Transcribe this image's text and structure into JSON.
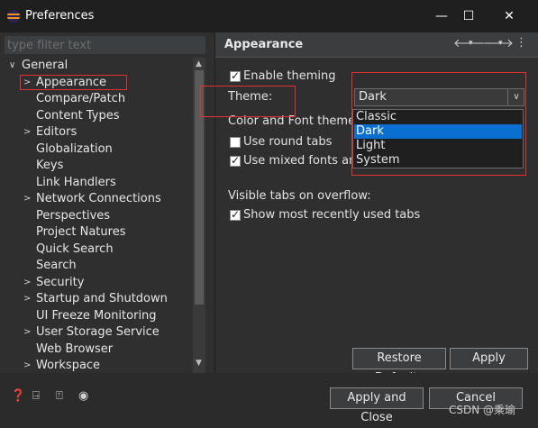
{
  "window": {
    "title": "Preferences",
    "minimize": "—",
    "maximize": "☐",
    "close": "✕"
  },
  "left": {
    "filter_placeholder": "type filter text",
    "tree": [
      {
        "label": "General",
        "chevron": "∨"
      },
      {
        "label": "Appearance",
        "chevron": ">"
      },
      {
        "label": "Compare/Patch",
        "chevron": ""
      },
      {
        "label": "Content Types",
        "chevron": ""
      },
      {
        "label": "Editors",
        "chevron": ">"
      },
      {
        "label": "Globalization",
        "chevron": ""
      },
      {
        "label": "Keys",
        "chevron": ""
      },
      {
        "label": "Link Handlers",
        "chevron": ""
      },
      {
        "label": "Network Connections",
        "chevron": ">"
      },
      {
        "label": "Perspectives",
        "chevron": ""
      },
      {
        "label": "Project Natures",
        "chevron": ""
      },
      {
        "label": "Quick Search",
        "chevron": ""
      },
      {
        "label": "Search",
        "chevron": ""
      },
      {
        "label": "Security",
        "chevron": ">"
      },
      {
        "label": "Startup and Shutdown",
        "chevron": ">"
      },
      {
        "label": "UI Freeze Monitoring",
        "chevron": ""
      },
      {
        "label": "User Storage Service",
        "chevron": ">"
      },
      {
        "label": "Web Browser",
        "chevron": ""
      },
      {
        "label": "Workspace",
        "chevron": ">"
      }
    ]
  },
  "right": {
    "title": "Appearance",
    "enable_theming": "Enable theming",
    "theme_label": "Theme:",
    "theme_value": "Dark",
    "theme_options": [
      "Classic",
      "Dark",
      "Light",
      "System"
    ],
    "color_font_theme_label": "Color and Font theme:",
    "use_round_tabs": "Use round tabs",
    "use_mixed_fonts": "Use mixed fonts and",
    "visible_tabs_label": "Visible tabs on overflow:",
    "show_mru_tabs": "Show most recently used tabs",
    "restore_defaults": "Restore Defaults",
    "apply": "Apply"
  },
  "bottom": {
    "apply_and_close": "Apply and Close",
    "cancel": "Cancel",
    "watermark": "CSDN @乘瑜"
  }
}
